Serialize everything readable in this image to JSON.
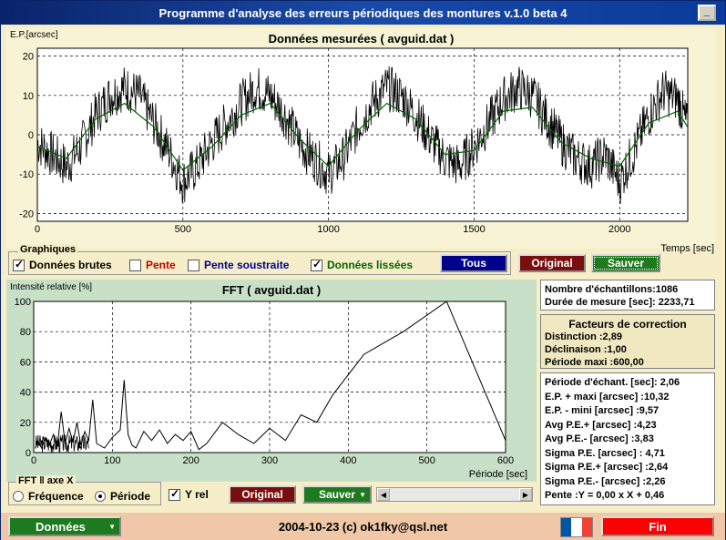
{
  "window": {
    "title": "Programme d'analyse des erreurs périodiques des montures v.1.0 beta 4",
    "minimize_label": "_"
  },
  "top_plot": {
    "title": "Données mesurées ( avguid.dat )",
    "ylabel": "E.P.[arcsec]",
    "xlabel": "Temps [sec]",
    "x_ticks": [
      "0",
      "500",
      "1000",
      "1500",
      "2000"
    ],
    "y_ticks": [
      "20",
      "10",
      "0",
      "-10",
      "-20"
    ]
  },
  "graphiques": {
    "legend": "Graphiques",
    "items": [
      {
        "label": "Données brutes",
        "checked": true,
        "color": "#000000"
      },
      {
        "label": "Pente",
        "checked": false,
        "color": "#c00000"
      },
      {
        "label": "Pente soustraite",
        "checked": false,
        "color": "#00008b"
      },
      {
        "label": "Données lissées",
        "checked": true,
        "color": "#006400"
      }
    ]
  },
  "top_buttons": {
    "tous": "Tous",
    "original": "Original",
    "sauver": "Sauver"
  },
  "fft_plot": {
    "title": "FFT ( avguid.dat )",
    "ylabel": "Intensité relative [%]",
    "xlabel": "Période [sec]",
    "x_ticks": [
      "0",
      "100",
      "200",
      "300",
      "400",
      "500",
      "600"
    ],
    "y_ticks": [
      "100",
      "80",
      "60",
      "40",
      "20",
      "0"
    ]
  },
  "fft_controls": {
    "axis_legend": "FFT ‖ axe X",
    "freq_label": "Fréquence",
    "period_label": "Période",
    "yrel_label": "Y rel",
    "original_label": "Original",
    "sauver_label": "Sauver"
  },
  "stats": {
    "samples": "Nombre d'échantillons:1086",
    "duration": "Durée de mesure [sec]: 2233,71"
  },
  "correction": {
    "title": "Facteurs de correction",
    "lines": [
      "Distinction :2,89",
      "Déclinaison :1,00",
      "Période maxi :600,00"
    ]
  },
  "results": {
    "lines": [
      "Période d'échant. [sec]: 2,06",
      "E.P. + maxi [arcsec] :10,32",
      "E.P. - mini [arcsec] :9,57",
      "Avg P.E.+ [arcsec] :4,23",
      "Avg P.E.- [arcsec] :3,83",
      "Sigma P.E. [arcsec] : 4,71",
      "Sigma P.E.+ [arcsec] :2,64",
      "Sigma P.E.- [arcsec] :2,26",
      "Pente :Y = 0,00 x X + 0,46"
    ]
  },
  "footer": {
    "donnees_label": "Données",
    "credit": "2004-10-23 (c) ok1fky@qsl.net",
    "fin_label": "Fin"
  },
  "chart_data": [
    {
      "type": "line",
      "title": "Données mesurées ( avguid.dat )",
      "xlabel": "Temps [sec]",
      "ylabel": "E.P.[arcsec]",
      "xlim": [
        0,
        2233.71
      ],
      "ylim": [
        -22,
        22
      ],
      "grid": true,
      "series": [
        {
          "name": "Données brutes",
          "x": [
            0,
            50,
            100,
            150,
            200,
            250,
            300,
            350,
            400,
            450,
            500,
            550,
            600,
            650,
            700,
            750,
            800,
            850,
            900,
            950,
            1000,
            1050,
            1100,
            1150,
            1200,
            1250,
            1300,
            1350,
            1400,
            1450,
            1500,
            1550,
            1600,
            1650,
            1700,
            1750,
            1800,
            1850,
            1900,
            1950,
            2000,
            2050,
            2100,
            2150,
            2200,
            2233
          ],
          "y": [
            -2,
            -5,
            -8,
            -3,
            5,
            10,
            12,
            10,
            3,
            -4,
            -12,
            -8,
            -2,
            3,
            8,
            12,
            10,
            5,
            -2,
            -6,
            -10,
            -6,
            2,
            8,
            12,
            10,
            5,
            -1,
            -6,
            -8,
            -3,
            3,
            9,
            12,
            10,
            4,
            -2,
            -6,
            -8,
            -5,
            -12,
            -4,
            5,
            11,
            9,
            2
          ]
        },
        {
          "name": "Données lissées",
          "x": [
            0,
            100,
            200,
            300,
            400,
            500,
            600,
            700,
            800,
            900,
            1000,
            1100,
            1200,
            1300,
            1400,
            1500,
            1600,
            1700,
            1800,
            1900,
            2000,
            2100,
            2200,
            2233
          ],
          "y": [
            -3,
            -6,
            4,
            8,
            2,
            -9,
            -3,
            5,
            8,
            -1,
            -8,
            1,
            8,
            4,
            -5,
            -4,
            6,
            7,
            -2,
            -6,
            -8,
            3,
            6,
            2
          ]
        }
      ]
    },
    {
      "type": "line",
      "title": "FFT ( avguid.dat )",
      "xlabel": "Période [sec]",
      "ylabel": "Intensité relative [%]",
      "xlim": [
        0,
        600
      ],
      "ylim": [
        0,
        100
      ],
      "grid": true,
      "series": [
        {
          "x": [
            5,
            10,
            15,
            20,
            25,
            30,
            35,
            40,
            45,
            50,
            55,
            60,
            65,
            70,
            75,
            80,
            90,
            100,
            110,
            115,
            120,
            125,
            130,
            140,
            150,
            160,
            170,
            180,
            190,
            200,
            210,
            220,
            240,
            260,
            280,
            300,
            320,
            340,
            360,
            380,
            420,
            470,
            525,
            600
          ],
          "y": [
            8,
            3,
            10,
            5,
            12,
            4,
            27,
            6,
            16,
            7,
            20,
            5,
            14,
            8,
            35,
            6,
            3,
            10,
            15,
            48,
            12,
            5,
            3,
            14,
            8,
            15,
            6,
            12,
            8,
            14,
            2,
            6,
            20,
            12,
            6,
            16,
            8,
            25,
            20,
            38,
            65,
            80,
            100,
            8
          ]
        }
      ]
    }
  ]
}
